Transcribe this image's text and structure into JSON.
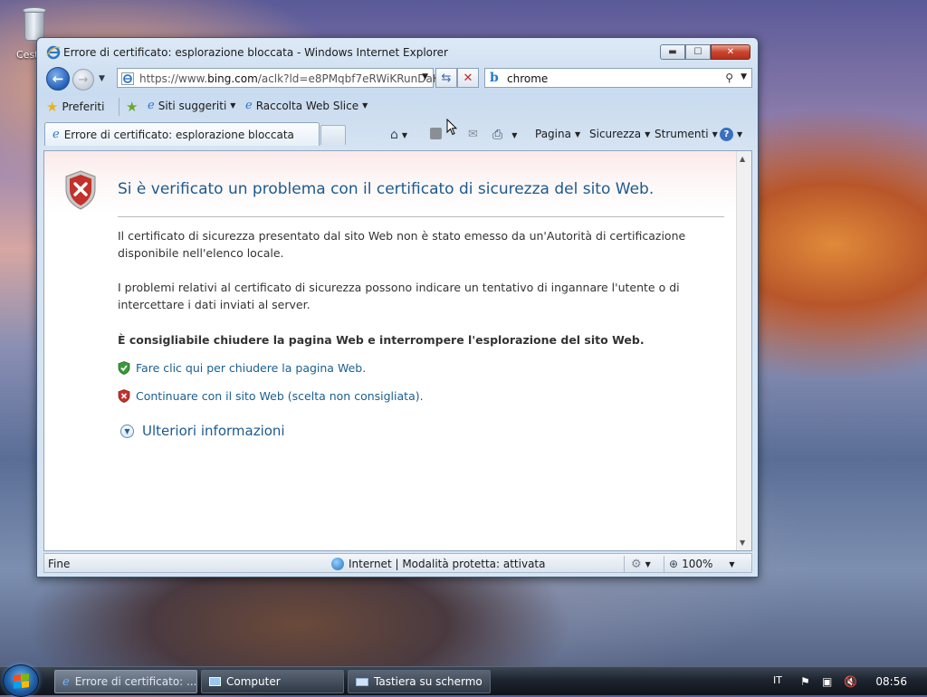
{
  "desktop": {
    "icons": [
      {
        "label": "Cest"
      }
    ]
  },
  "window": {
    "title": "Errore di certificato: esplorazione bloccata - Windows Internet Explorer",
    "caption": {
      "minimize": "▬",
      "maximize": "☐",
      "close": "✕"
    }
  },
  "address_bar": {
    "url_prefix": "https://www.",
    "url_host": "bing.com",
    "url_rest": "/aclk?ld=e8PMqbf7eRWiKRunDaK"
  },
  "search_box": {
    "value": "chrome"
  },
  "favorites_bar": {
    "favorites_label": "Preferiti",
    "suggested_sites": "Siti suggeriti",
    "web_slice_gallery": "Raccolta Web Slice"
  },
  "tab": {
    "title": "Errore di certificato: esplorazione bloccata"
  },
  "command_bar": {
    "page": "Pagina",
    "safety": "Sicurezza",
    "tools": "Strumenti"
  },
  "content": {
    "heading": "Si è verificato un problema con il certificato di sicurezza del sito Web.",
    "paragraph1_line1": "Il certificato di sicurezza presentato dal sito Web non è stato emesso da un'Autorità di certificazione",
    "paragraph1_line2": "disponibile nell'elenco locale.",
    "paragraph2_line1": "I problemi relativi al certificato di sicurezza possono indicare un tentativo di ingannare l'utente o di",
    "paragraph2_line2": "intercettare i dati inviati al server.",
    "recommendation": "È consigliabile chiudere la pagina Web e interrompere l'esplorazione del sito Web.",
    "close_link": "Fare clic qui per chiudere la pagina Web.",
    "continue_link": "Continuare con il sito Web (scelta non consigliata).",
    "more_info": "Ulteriori informazioni"
  },
  "status_bar": {
    "status": "Fine",
    "zone": "Internet | Modalità protetta: attivata",
    "zoom": "100%"
  },
  "taskbar": {
    "tasks": [
      {
        "label": "Errore di certificato: ..."
      },
      {
        "label": "Computer"
      },
      {
        "label": "Tastiera su schermo"
      }
    ],
    "language": "IT",
    "clock": "08:56"
  },
  "colors": {
    "heading": "#1d5a8e",
    "link": "#1a5f8f",
    "close_button": "#c9452e"
  }
}
